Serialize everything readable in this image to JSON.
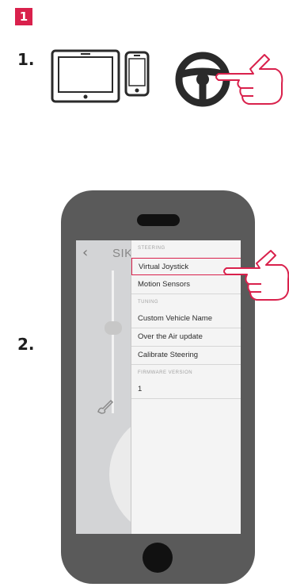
{
  "step_badge": "1",
  "step_1_label": "1.",
  "step_2_label": "2.",
  "app": {
    "title": "SIKI"
  },
  "menu": {
    "steering_header": "STEERING",
    "virtual_joystick": "Virtual Joystick",
    "motion_sensors": "Motion Sensors",
    "tuning_header": "TUNING",
    "custom_vehicle_name": "Custom Vehicle Name",
    "ota_update": "Over the Air update",
    "calibrate_steering": "Calibrate Steering",
    "firmware_header": "FIRMWARE VERSION",
    "firmware_value": "1"
  },
  "colors": {
    "accent": "#d9214c",
    "phone_body": "#5a5a5a",
    "device_outline": "#2a2a2a"
  },
  "icons": [
    "tablet-icon",
    "smartphone-icon",
    "steering-wheel-icon",
    "tap-hand-icon",
    "back-chevron-icon",
    "pen-icon"
  ]
}
